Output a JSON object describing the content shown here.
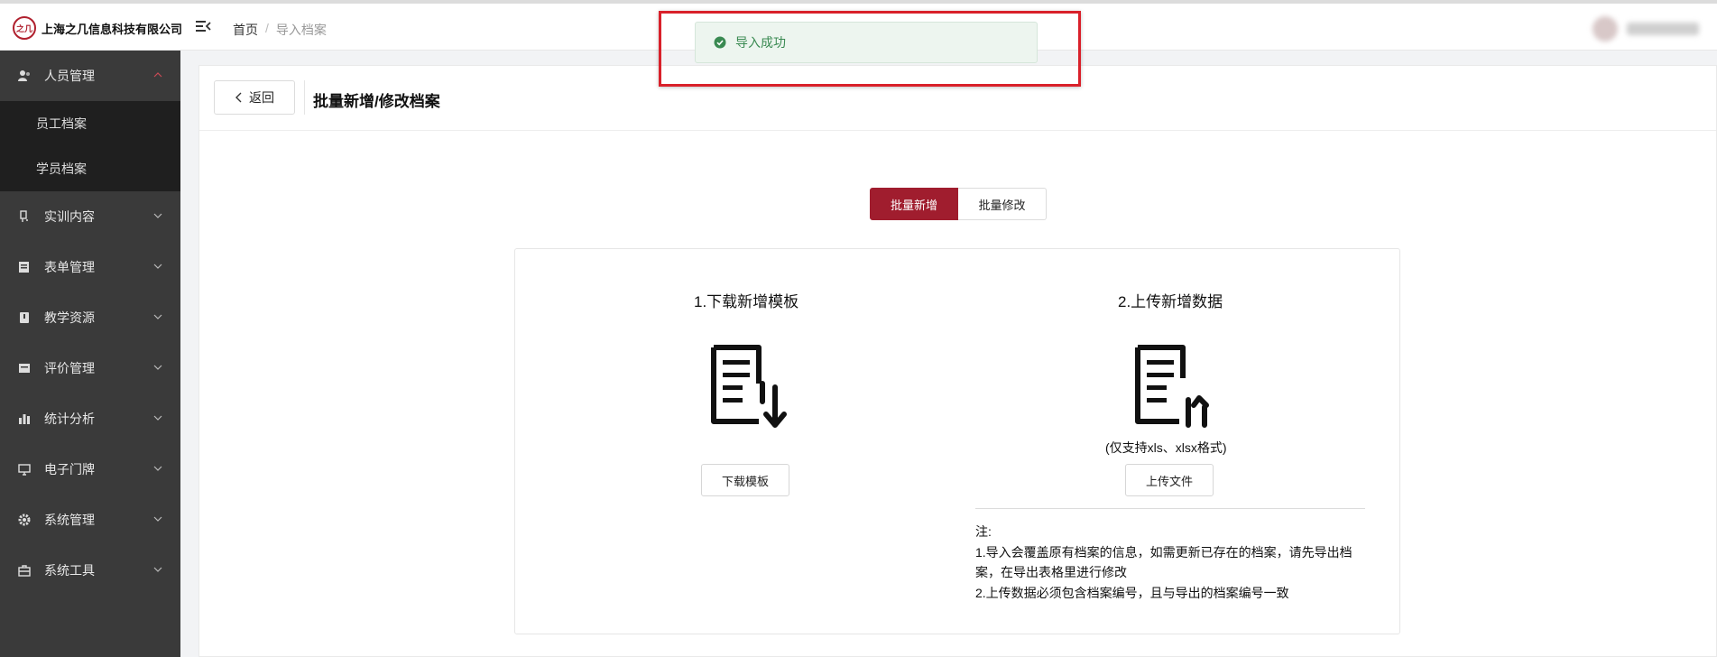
{
  "header": {
    "logo_mark": "之几",
    "company": "上海之几信息科技有限公司",
    "breadcrumb": {
      "home": "首页",
      "separator": "/",
      "current": "导入档案"
    }
  },
  "sidebar": {
    "items": [
      {
        "label": "人员管理",
        "icon": "user-icon",
        "expanded": true,
        "children": [
          "员工档案",
          "学员档案"
        ]
      },
      {
        "label": "实训内容",
        "icon": "training-icon"
      },
      {
        "label": "表单管理",
        "icon": "form-icon"
      },
      {
        "label": "教学资源",
        "icon": "resource-icon"
      },
      {
        "label": "评价管理",
        "icon": "evaluation-icon"
      },
      {
        "label": "统计分析",
        "icon": "bar-chart-icon"
      },
      {
        "label": "电子门牌",
        "icon": "monitor-icon"
      },
      {
        "label": "系统管理",
        "icon": "gear-icon"
      },
      {
        "label": "系统工具",
        "icon": "toolbox-icon"
      }
    ]
  },
  "page": {
    "back_label": "返回",
    "title": "批量新增/修改档案",
    "tabs": {
      "add": "批量新增",
      "edit": "批量修改",
      "active": "add"
    },
    "download": {
      "title": "1.下载新增模板",
      "button": "下载模板"
    },
    "upload": {
      "title": "2.上传新增数据",
      "support": "(仅支持xls、xlsx格式)",
      "button": "上传文件"
    },
    "notes": {
      "heading": "注:",
      "line1": "1.导入会覆盖原有档案的信息，如需更新已存在的档案，请先导出档案，在导出表格里进行修改",
      "line2": "2.上传数据必须包含档案编号，且与导出的档案编号一致"
    }
  },
  "toast": {
    "message": "导入成功",
    "type": "success"
  },
  "colors": {
    "brand": "#a01d2e",
    "sidebar": "#3a3a3a",
    "success": "#3a8a52",
    "highlight": "#d9202a"
  }
}
